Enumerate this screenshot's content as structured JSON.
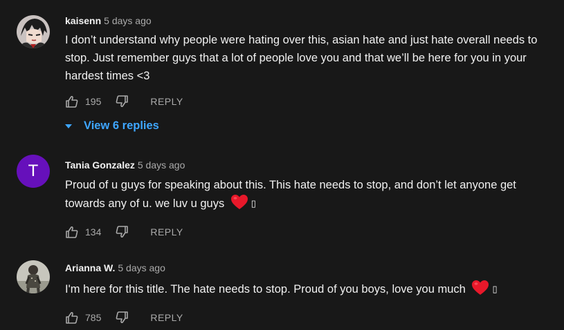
{
  "comments": [
    {
      "author": "kaisenn",
      "time": "5 days ago",
      "text": "I don’t understand why people were hating over this, asian hate and just hate overall needs to stop. Just remember guys that a lot of people love you and that we’ll be here for you in your hardest times <3",
      "likes": "195",
      "reply_label": "REPLY",
      "replies_label": "View 6 replies",
      "avatar": "anime-character-avatar"
    },
    {
      "author": "Tania Gonzalez",
      "time": "5 days ago",
      "text": "Proud of u guys for speaking about this. This hate needs to stop, and don’t let anyone get towards any of u. we luv u guys",
      "likes": "134",
      "reply_label": "REPLY",
      "avatar_letter": "T",
      "avatar_color": "#6610bb",
      "emoji": "red-heart",
      "trailing_glyph": "▯"
    },
    {
      "author": "Arianna W.",
      "time": "5 days ago",
      "text": "I'm here for this title. The hate needs to stop. Proud of you boys, love you much",
      "likes": "785",
      "reply_label": "REPLY",
      "avatar": "photo-avatar",
      "emoji": "red-heart",
      "trailing_glyph": "▯"
    }
  ],
  "colors": {
    "background": "#181818",
    "text": "#f1f1f1",
    "secondary": "#aaaaaa",
    "link": "#3ea6ff",
    "heart": "#e8182a"
  }
}
